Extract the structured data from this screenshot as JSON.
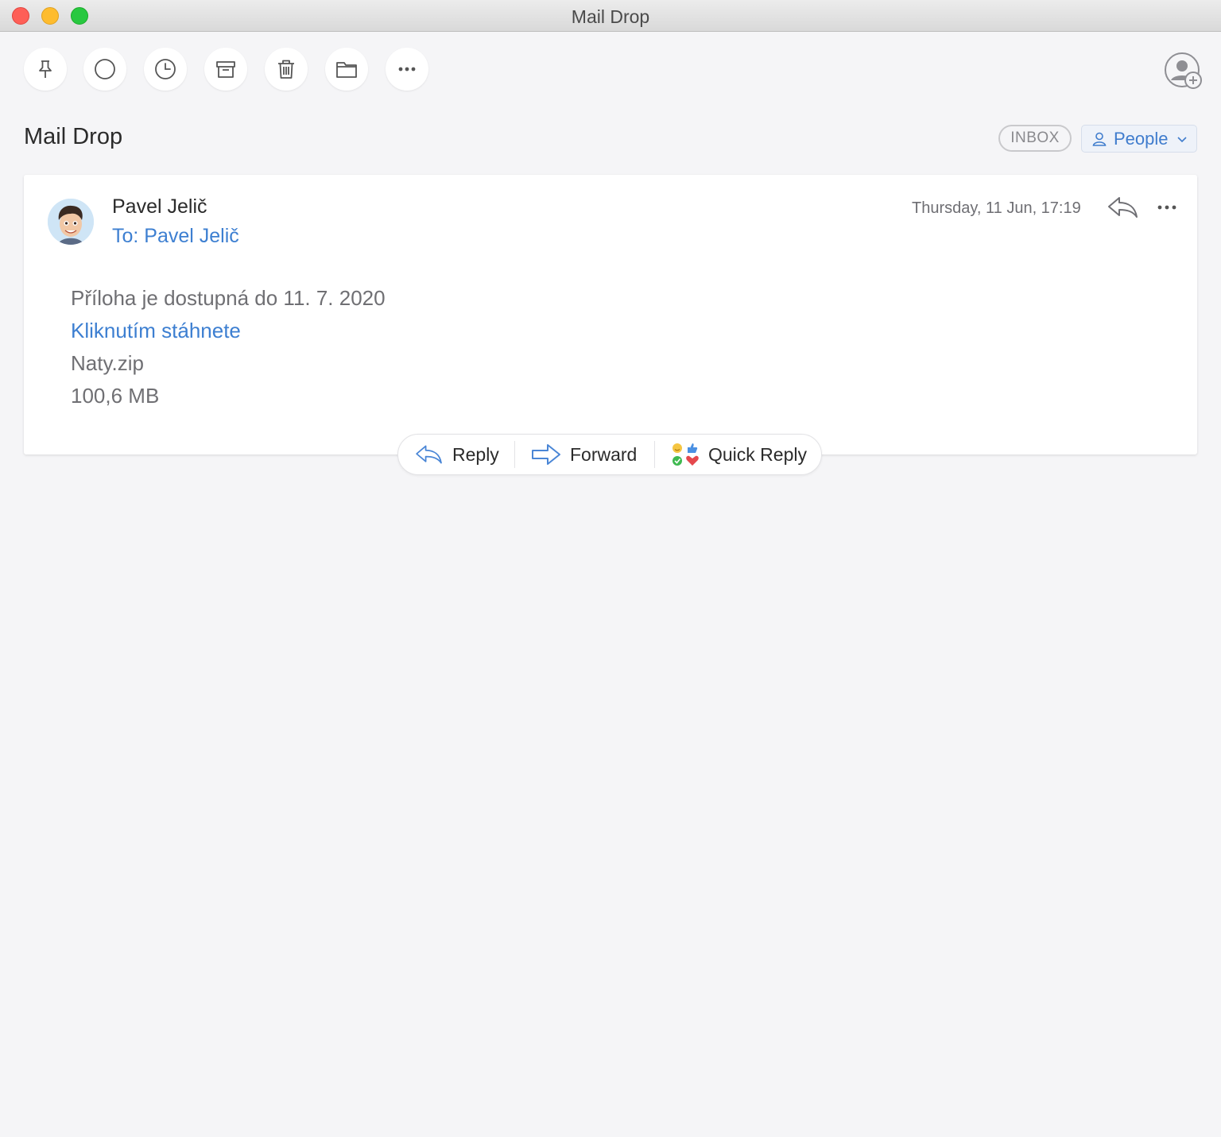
{
  "window": {
    "title": "Mail Drop"
  },
  "toolbar": {
    "buttons": [
      {
        "name": "pin",
        "icon": "pin-icon"
      },
      {
        "name": "mark-read",
        "icon": "circle-icon"
      },
      {
        "name": "snooze",
        "icon": "clock-icon"
      },
      {
        "name": "archive",
        "icon": "archive-icon"
      },
      {
        "name": "delete",
        "icon": "trash-icon"
      },
      {
        "name": "move",
        "icon": "folder-icon"
      },
      {
        "name": "more",
        "icon": "ellipsis-icon"
      }
    ],
    "account_icon": "add-account-icon"
  },
  "header": {
    "folder_title": "Mail Drop",
    "inbox_badge": "INBOX",
    "people_label": "People"
  },
  "message": {
    "sender": "Pavel Jelič",
    "recipient": "To: Pavel Jelič",
    "date": "Thursday, 11 Jun, 17:19",
    "body": {
      "availability": "Příloha je dostupná do 11. 7. 2020",
      "download_link": "Kliknutím stáhnete",
      "file_name": "Naty.zip",
      "file_size": "100,6 MB"
    }
  },
  "actions": {
    "reply": "Reply",
    "forward": "Forward",
    "quick_reply": "Quick Reply"
  },
  "colors": {
    "accent": "#3d7fd1",
    "background": "#f5f5f7",
    "card": "#ffffff",
    "close": "#fe5f57",
    "minimize": "#febc2e",
    "maximize": "#28c840"
  }
}
